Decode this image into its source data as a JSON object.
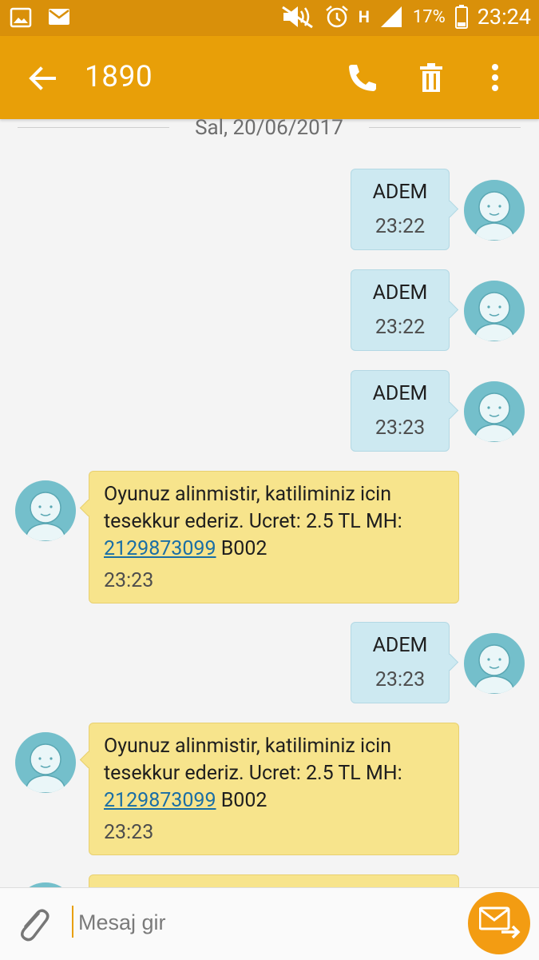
{
  "status": {
    "battery_pct": "17%",
    "time": "23:24",
    "network": "H"
  },
  "header": {
    "title": "1890"
  },
  "date_label": "Sal, 20/06/2017",
  "messages": [
    {
      "dir": "out",
      "text": "ADEM",
      "time": "23:22"
    },
    {
      "dir": "out",
      "text": "ADEM",
      "time": "23:22"
    },
    {
      "dir": "out",
      "text": "ADEM",
      "time": "23:23"
    },
    {
      "dir": "in",
      "text_a": "Oyunuz alinmistir, katiliminiz icin tesekkur ederiz. Ucret: 2.5 TL MH:",
      "link": "2129873099",
      "text_b": "B002",
      "time": "23:23"
    },
    {
      "dir": "out",
      "text": "ADEM",
      "time": "23:23"
    },
    {
      "dir": "in",
      "text_a": "Oyunuz alinmistir, katiliminiz icin tesekkur ederiz. Ucret: 2.5 TL MH:",
      "link": "2129873099",
      "text_b": "B002",
      "time": "23:23"
    }
  ],
  "composer": {
    "placeholder": "Mesaj gir"
  },
  "colors": {
    "statusbar": "#d9900a",
    "appbar": "#e89f08",
    "outgoing": "#cde9f1",
    "incoming": "#f7e48c",
    "send": "#f39c12",
    "link": "#1a6ea5"
  }
}
